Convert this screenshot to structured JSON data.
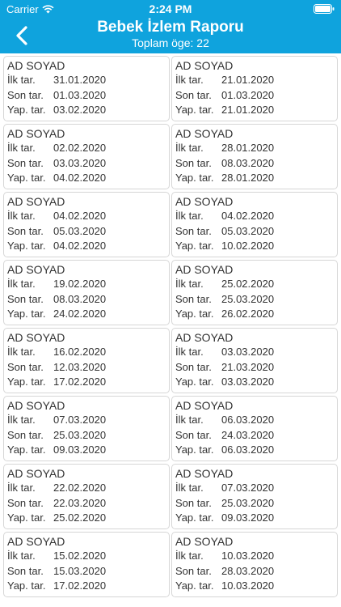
{
  "status_bar": {
    "carrier": "Carrier",
    "time": "2:24 PM"
  },
  "header": {
    "title": "Bebek İzlem Raporu",
    "subtitle": "Toplam öge: 22",
    "back_icon": "chevron-left-icon"
  },
  "labels": {
    "first": "İlk tar.",
    "last": "Son tar.",
    "done": "Yap. tar."
  },
  "records": [
    {
      "name": "AD SOYAD",
      "first": "31.01.2020",
      "last": "01.03.2020",
      "done": "03.02.2020"
    },
    {
      "name": "AD SOYAD",
      "first": "21.01.2020",
      "last": "01.03.2020",
      "done": "21.01.2020"
    },
    {
      "name": "AD SOYAD",
      "first": "02.02.2020",
      "last": "03.03.2020",
      "done": "04.02.2020"
    },
    {
      "name": "AD SOYAD",
      "first": "28.01.2020",
      "last": "08.03.2020",
      "done": "28.01.2020"
    },
    {
      "name": "AD SOYAD",
      "first": "04.02.2020",
      "last": "05.03.2020",
      "done": "04.02.2020"
    },
    {
      "name": "AD SOYAD",
      "first": "04.02.2020",
      "last": "05.03.2020",
      "done": "10.02.2020"
    },
    {
      "name": "AD SOYAD",
      "first": "19.02.2020",
      "last": "08.03.2020",
      "done": "24.02.2020"
    },
    {
      "name": "AD SOYAD",
      "first": "25.02.2020",
      "last": "25.03.2020",
      "done": "26.02.2020"
    },
    {
      "name": "AD SOYAD",
      "first": "16.02.2020",
      "last": "12.03.2020",
      "done": "17.02.2020"
    },
    {
      "name": "AD SOYAD",
      "first": "03.03.2020",
      "last": "21.03.2020",
      "done": "03.03.2020"
    },
    {
      "name": "AD SOYAD",
      "first": "07.03.2020",
      "last": "25.03.2020",
      "done": "09.03.2020"
    },
    {
      "name": "AD SOYAD",
      "first": "06.03.2020",
      "last": "24.03.2020",
      "done": "06.03.2020"
    },
    {
      "name": "AD SOYAD",
      "first": "22.02.2020",
      "last": "22.03.2020",
      "done": "25.02.2020"
    },
    {
      "name": "AD SOYAD",
      "first": "07.03.2020",
      "last": "25.03.2020",
      "done": "09.03.2020"
    },
    {
      "name": "AD SOYAD",
      "first": "15.02.2020",
      "last": "15.03.2020",
      "done": "17.02.2020"
    },
    {
      "name": "AD SOYAD",
      "first": "10.03.2020",
      "last": "28.03.2020",
      "done": "10.03.2020"
    }
  ]
}
